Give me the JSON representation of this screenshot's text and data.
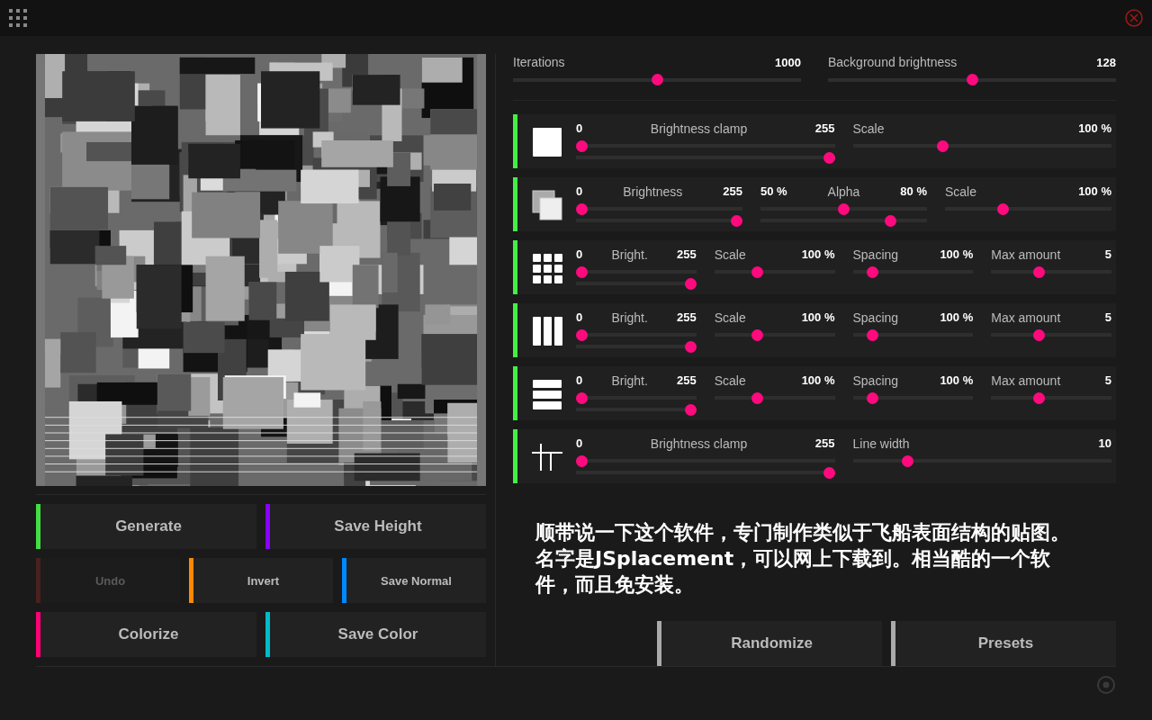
{
  "top_sliders": [
    {
      "label": "Iterations",
      "reading": "1000",
      "level": 0.5
    },
    {
      "label": "Background brightness",
      "reading": "128",
      "level": 0.5
    }
  ],
  "layers": [
    {
      "kind": "square",
      "enabled": true,
      "controls": [
        {
          "kind": "range",
          "min": "0",
          "label": "Brightness clamp",
          "max": "255",
          "thumbs": [
            {
              "level": 0
            },
            {
              "level": 1
            }
          ]
        },
        {
          "kind": "single",
          "label": "Scale",
          "reading": "100 %",
          "level": 0.34
        }
      ]
    },
    {
      "kind": "overlap",
      "enabled": true,
      "controls": [
        {
          "kind": "range",
          "min": "0",
          "label": "Brightness",
          "max": "255",
          "thumbs": [
            {
              "level": 0
            },
            {
              "level": 1
            }
          ]
        },
        {
          "kind": "range",
          "min": "50 %",
          "label": "Alpha",
          "max": "80 %",
          "thumbs": [
            {
              "level": 0.5
            },
            {
              "level": 0.8
            }
          ]
        },
        {
          "kind": "single",
          "label": "Scale",
          "reading": "100 %",
          "level": 0.34
        }
      ]
    },
    {
      "kind": "grid",
      "enabled": true,
      "controls": [
        {
          "kind": "range",
          "min": "0",
          "label": "Bright.",
          "max": "255",
          "thumbs": [
            {
              "level": 0
            },
            {
              "level": 1
            }
          ]
        },
        {
          "kind": "single",
          "label": "Scale",
          "reading": "100 %",
          "level": 0.34
        },
        {
          "kind": "single",
          "label": "Spacing",
          "reading": "100 %",
          "level": 0.13
        },
        {
          "kind": "single",
          "label": "Max amount",
          "reading": "5",
          "level": 0.39
        }
      ]
    },
    {
      "kind": "columns",
      "enabled": true,
      "controls": [
        {
          "kind": "range",
          "min": "0",
          "label": "Bright.",
          "max": "255",
          "thumbs": [
            {
              "level": 0
            },
            {
              "level": 1
            }
          ]
        },
        {
          "kind": "single",
          "label": "Scale",
          "reading": "100 %",
          "level": 0.34
        },
        {
          "kind": "single",
          "label": "Spacing",
          "reading": "100 %",
          "level": 0.13
        },
        {
          "kind": "single",
          "label": "Max amount",
          "reading": "5",
          "level": 0.39
        }
      ]
    },
    {
      "kind": "rows",
      "enabled": true,
      "controls": [
        {
          "kind": "range",
          "min": "0",
          "label": "Bright.",
          "max": "255",
          "thumbs": [
            {
              "level": 0
            },
            {
              "level": 1
            }
          ]
        },
        {
          "kind": "single",
          "label": "Scale",
          "reading": "100 %",
          "level": 0.34
        },
        {
          "kind": "single",
          "label": "Spacing",
          "reading": "100 %",
          "level": 0.13
        },
        {
          "kind": "single",
          "label": "Max amount",
          "reading": "5",
          "level": 0.39
        }
      ]
    },
    {
      "kind": "lines",
      "enabled": true,
      "controls": [
        {
          "kind": "range",
          "min": "0",
          "label": "Brightness clamp",
          "max": "255",
          "thumbs": [
            {
              "level": 0
            },
            {
              "level": 1
            }
          ]
        },
        {
          "kind": "single",
          "label": "Line width",
          "reading": "10",
          "level": 0.2
        }
      ]
    }
  ],
  "button_rows": [
    [
      {
        "label": "Generate",
        "color": "#44dd44",
        "disabled": false
      },
      {
        "label": "Save Height",
        "color": "#8800ff",
        "disabled": false
      }
    ],
    [
      {
        "label": "Undo",
        "color": "#4a2020",
        "disabled": true
      },
      {
        "label": "Invert",
        "color": "#ff8800",
        "disabled": false
      },
      {
        "label": "Save Normal",
        "color": "#0088ff",
        "disabled": false
      }
    ],
    [
      {
        "label": "Colorize",
        "color": "#ff0077",
        "disabled": false
      },
      {
        "label": "Save Color",
        "color": "#00bbcc",
        "disabled": false
      }
    ]
  ],
  "caption": "顺带说一下这个软件，专门制作类似于飞船表面结构的贴图。名字是JSplacement，可以网上下载到。相当酷的一个软件，而且免安装。",
  "right_buttons": [
    {
      "label": "Randomize",
      "color": "#aaaaaa",
      "disabled": false
    },
    {
      "label": "Presets",
      "color": "#aaaaaa",
      "disabled": false
    }
  ]
}
